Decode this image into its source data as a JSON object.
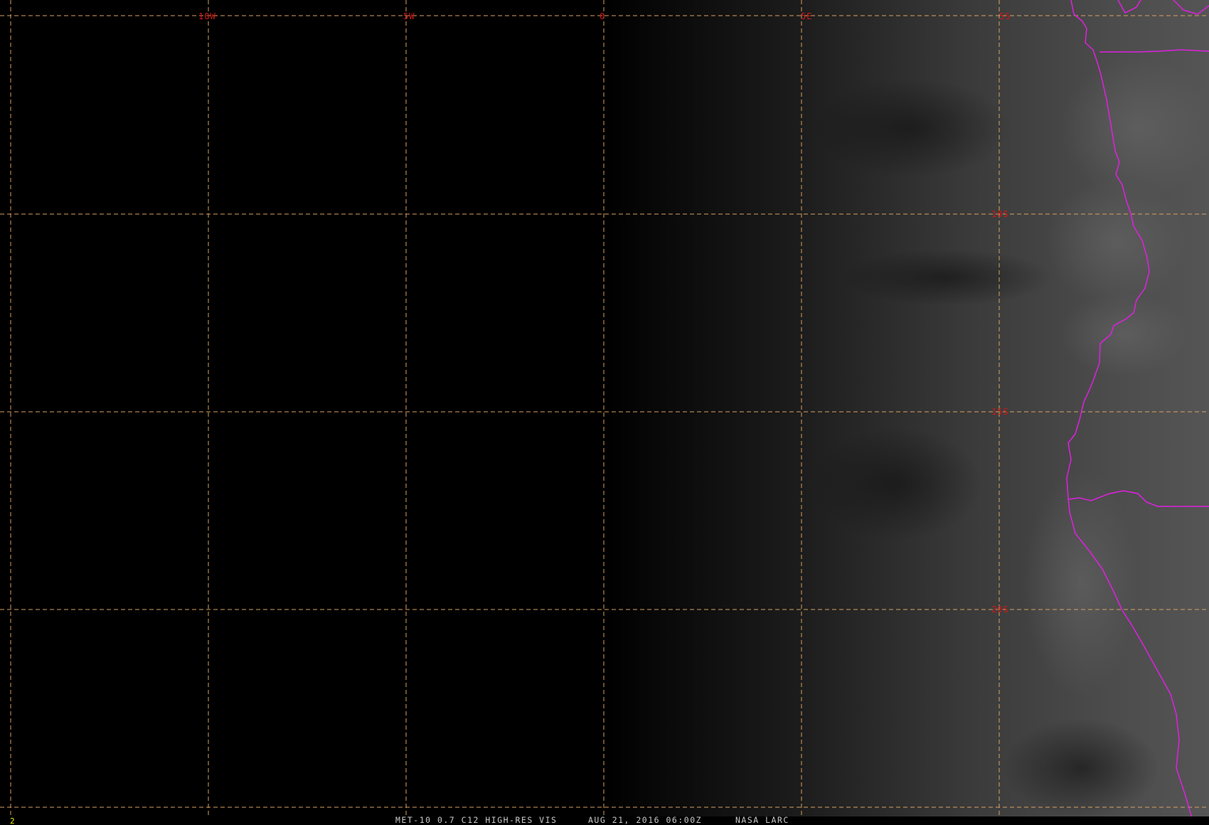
{
  "map": {
    "grid_color": "#d9a060",
    "label_color": "#d01818",
    "border_color": "#e020e0",
    "longitude_labels": [
      "10W",
      "5W",
      "0",
      "5E"
    ],
    "latitude_labels": [
      "5S",
      "10S",
      "15S",
      "20S"
    ]
  },
  "status_bar": {
    "frame_number": "2",
    "product": "MET-10 0.7 C12 HIGH-RES VIS",
    "datetime": "AUG 21, 2016 06:00Z",
    "source": "NASA LARC"
  }
}
